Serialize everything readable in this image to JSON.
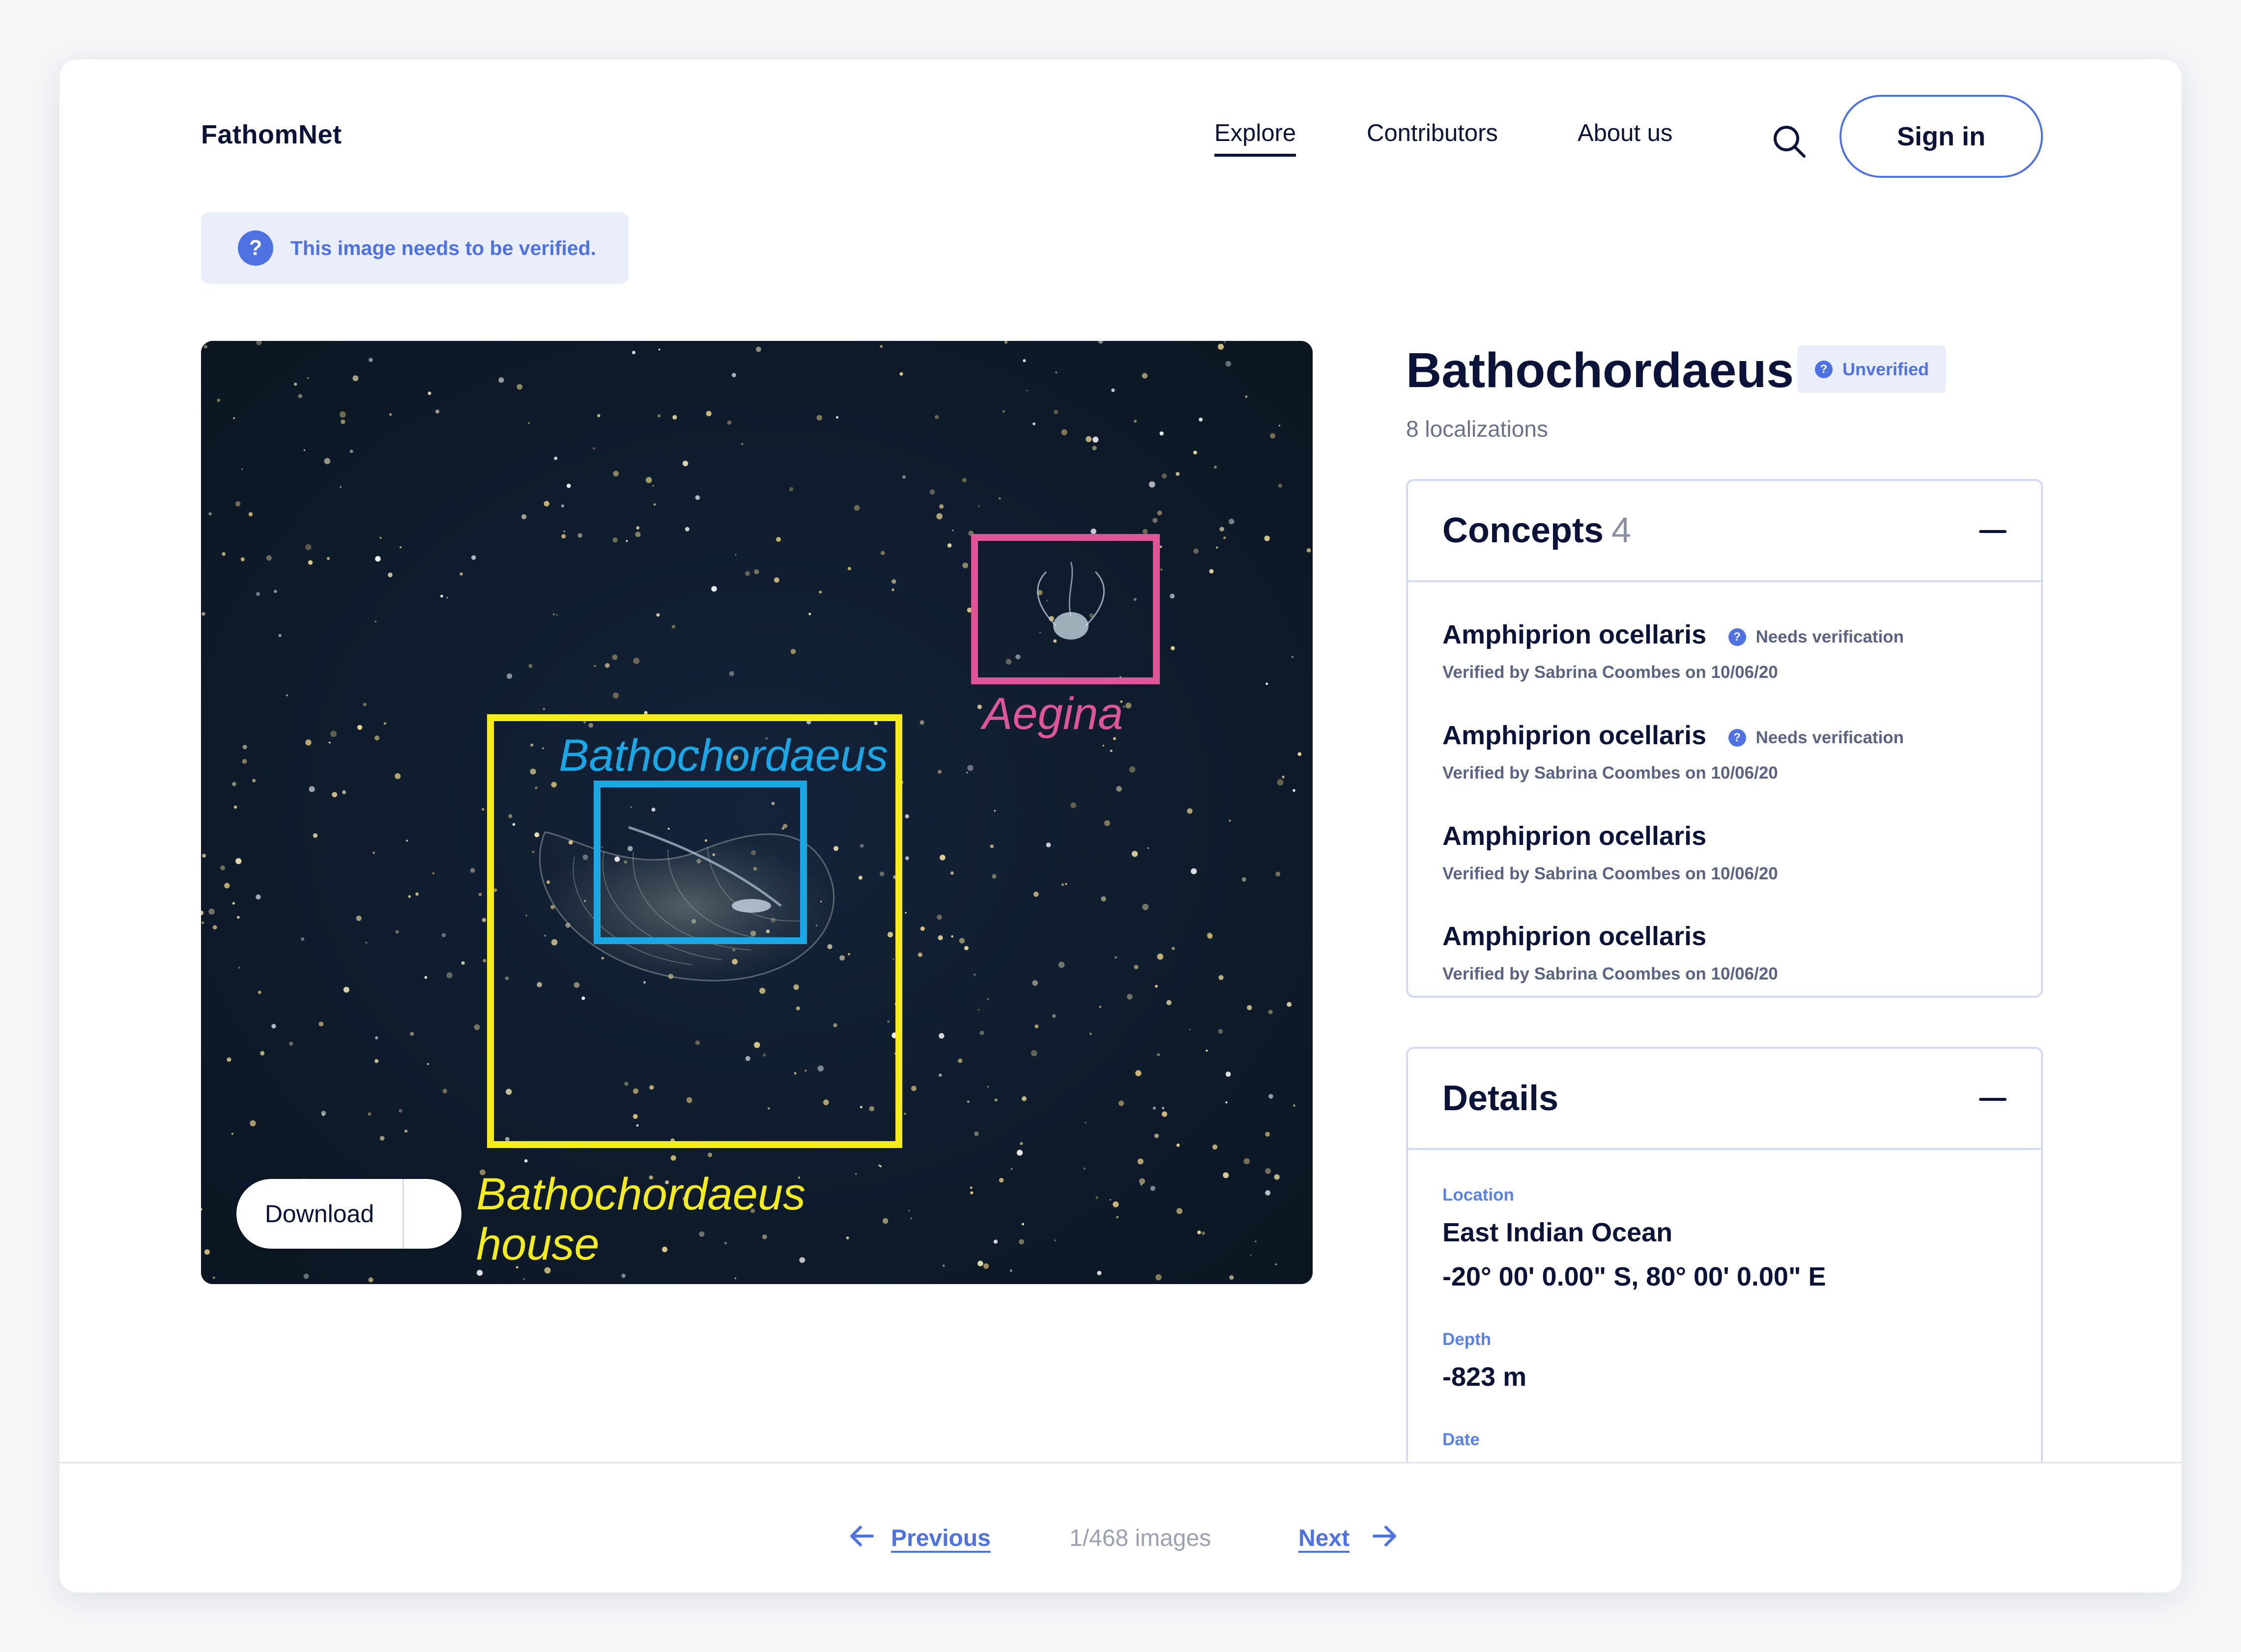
{
  "brand": {
    "name": "FathomNet"
  },
  "nav": {
    "explore": "Explore",
    "contributors": "Contributors",
    "about": "About us",
    "sign_in": "Sign in"
  },
  "banner": {
    "icon": "?",
    "text": "This image needs to be verified."
  },
  "image": {
    "labels": {
      "aegina": "Aegina",
      "bathochordaeus": "Bathochordaeus",
      "house_line1": "Bathochordaeus",
      "house_line2": "house"
    },
    "colors": {
      "aegina": "#e05597",
      "bathochordaeus": "#1aa7e6",
      "house": "#f4ec1d"
    },
    "download_label": "Download"
  },
  "species": {
    "title": "Bathochordaeus",
    "status": "Unverified",
    "localizations": "8 localizations"
  },
  "concepts": {
    "title": "Concepts",
    "count": "4",
    "items": [
      {
        "name": "Amphiprion ocellaris",
        "flag": "Needs verification",
        "meta": "Verified by Sabrina Coombes on 10/06/20"
      },
      {
        "name": "Amphiprion ocellaris",
        "flag": "Needs verification",
        "meta": "Verified by Sabrina Coombes on 10/06/20"
      },
      {
        "name": "Amphiprion ocellaris",
        "flag": "",
        "meta": "Verified by Sabrina Coombes on 10/06/20"
      },
      {
        "name": "Amphiprion ocellaris",
        "flag": "",
        "meta": "Verified by Sabrina Coombes on 10/06/20"
      }
    ]
  },
  "details": {
    "title": "Details",
    "location_label": "Location",
    "location_name": "East Indian Ocean",
    "coordinates": "-20° 00' 0.00\" S, 80° 00' 0.00\" E",
    "depth_label": "Depth",
    "depth_value": "-823 m",
    "date_label": "Date"
  },
  "pager": {
    "previous": "Previous",
    "count": "1/468 images",
    "next": "Next"
  },
  "theme": {
    "accent": "#4f72e3",
    "navy": "#0b1438",
    "muted": "#6b7287"
  }
}
